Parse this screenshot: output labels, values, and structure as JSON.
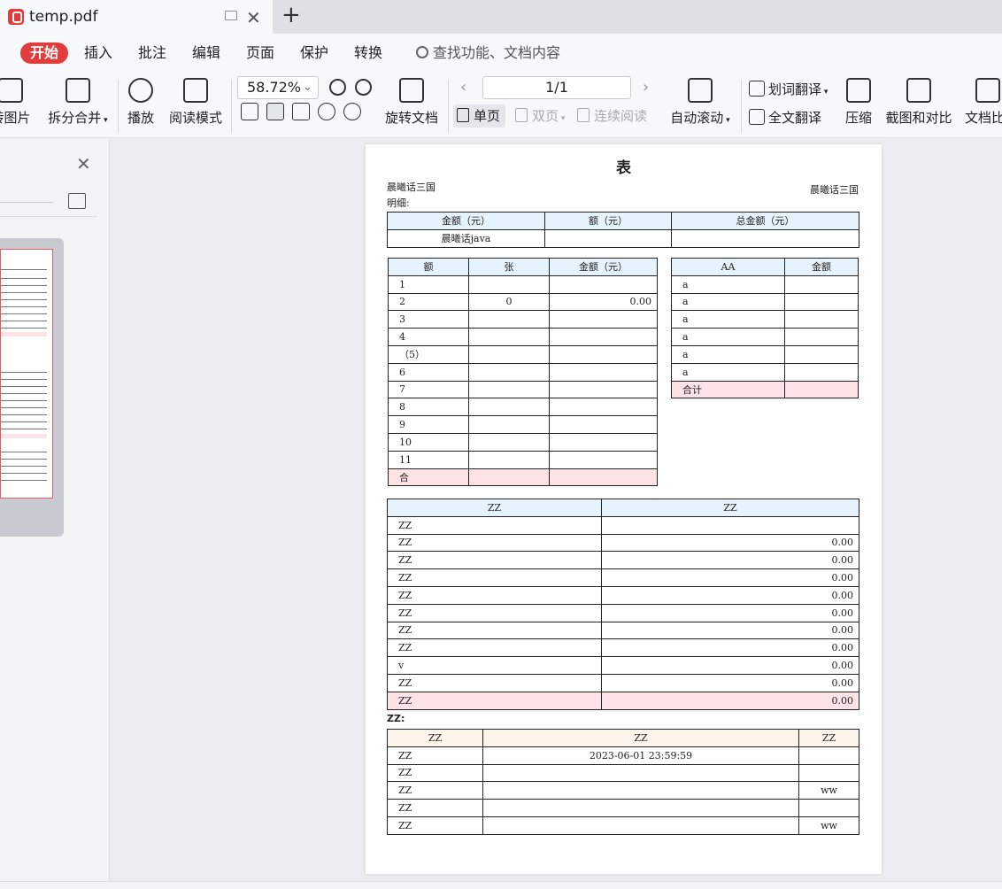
{
  "tab": {
    "title": "temp.pdf"
  },
  "menu": {
    "items": [
      {
        "label": "开始",
        "active": true
      },
      {
        "label": "插入"
      },
      {
        "label": "批注"
      },
      {
        "label": "编辑"
      },
      {
        "label": "页面"
      },
      {
        "label": "保护"
      },
      {
        "label": "转换"
      }
    ],
    "search_placeholder": "查找功能、文档内容"
  },
  "toolbar": {
    "to_image": "转图片",
    "split_merge": "拆分合并",
    "play": "播放",
    "read_mode": "阅读模式",
    "zoom": "58.72%",
    "rotate": "旋转文档",
    "page_indicator": "1/1",
    "single_page": "单页",
    "double_page": "双页",
    "continuous": "连续阅读",
    "auto_scroll": "自动滚动",
    "word_translate": "划词翻译",
    "full_translate": "全文翻译",
    "compress": "压缩",
    "screenshot_compare": "截图和对比",
    "doc_compare": "文档比"
  },
  "document": {
    "title": "表",
    "company_left": "晨曦话三国",
    "company_right": "晨曦话三国",
    "detail_label": "明细:",
    "summary_table": {
      "headers": [
        "金额（元）",
        "额（元）",
        "总金额（元）"
      ],
      "row": [
        "晨曦话java",
        "",
        ""
      ]
    },
    "left_table": {
      "headers": [
        "额",
        "张",
        "金额（元）"
      ],
      "rows": [
        [
          "1",
          "",
          ""
        ],
        [
          "2",
          "0",
          "0.00"
        ],
        [
          "3",
          "",
          ""
        ],
        [
          "4",
          "",
          ""
        ],
        [
          "（5）",
          "",
          ""
        ],
        [
          "6",
          "",
          ""
        ],
        [
          "7",
          "",
          ""
        ],
        [
          "8",
          "",
          ""
        ],
        [
          "9",
          "",
          ""
        ],
        [
          "10",
          "",
          ""
        ],
        [
          "11",
          "",
          ""
        ]
      ],
      "total": [
        "合",
        "",
        ""
      ]
    },
    "right_table": {
      "headers": [
        "AA",
        "金额"
      ],
      "rows": [
        [
          "a",
          ""
        ],
        [
          "a",
          ""
        ],
        [
          "a",
          ""
        ],
        [
          "a",
          ""
        ],
        [
          "a",
          ""
        ],
        [
          "a",
          ""
        ]
      ],
      "total": [
        "合计",
        ""
      ]
    },
    "zz_table": {
      "headers": [
        "ZZ",
        "ZZ"
      ],
      "rows": [
        [
          "ZZ",
          ""
        ],
        [
          "ZZ",
          "0.00"
        ],
        [
          "ZZ",
          "0.00"
        ],
        [
          "ZZ",
          "0.00"
        ],
        [
          "ZZ",
          "0.00"
        ],
        [
          "ZZ",
          "0.00"
        ],
        [
          "ZZ",
          "0.00"
        ],
        [
          "ZZ",
          "0.00"
        ],
        [
          "v",
          "0.00"
        ],
        [
          "ZZ",
          "0.00"
        ]
      ],
      "total": [
        "ZZ",
        "0.00"
      ]
    },
    "zz_label": "ZZ:",
    "bottom_table": {
      "headers": [
        "ZZ",
        "ZZ",
        "ZZ"
      ],
      "rows": [
        [
          "ZZ",
          "2023-06-01 23:59:59",
          ""
        ],
        [
          "ZZ",
          "",
          ""
        ],
        [
          "ZZ",
          "",
          "ww"
        ],
        [
          "ZZ",
          "",
          ""
        ],
        [
          "ZZ",
          "",
          "ww"
        ]
      ]
    }
  }
}
